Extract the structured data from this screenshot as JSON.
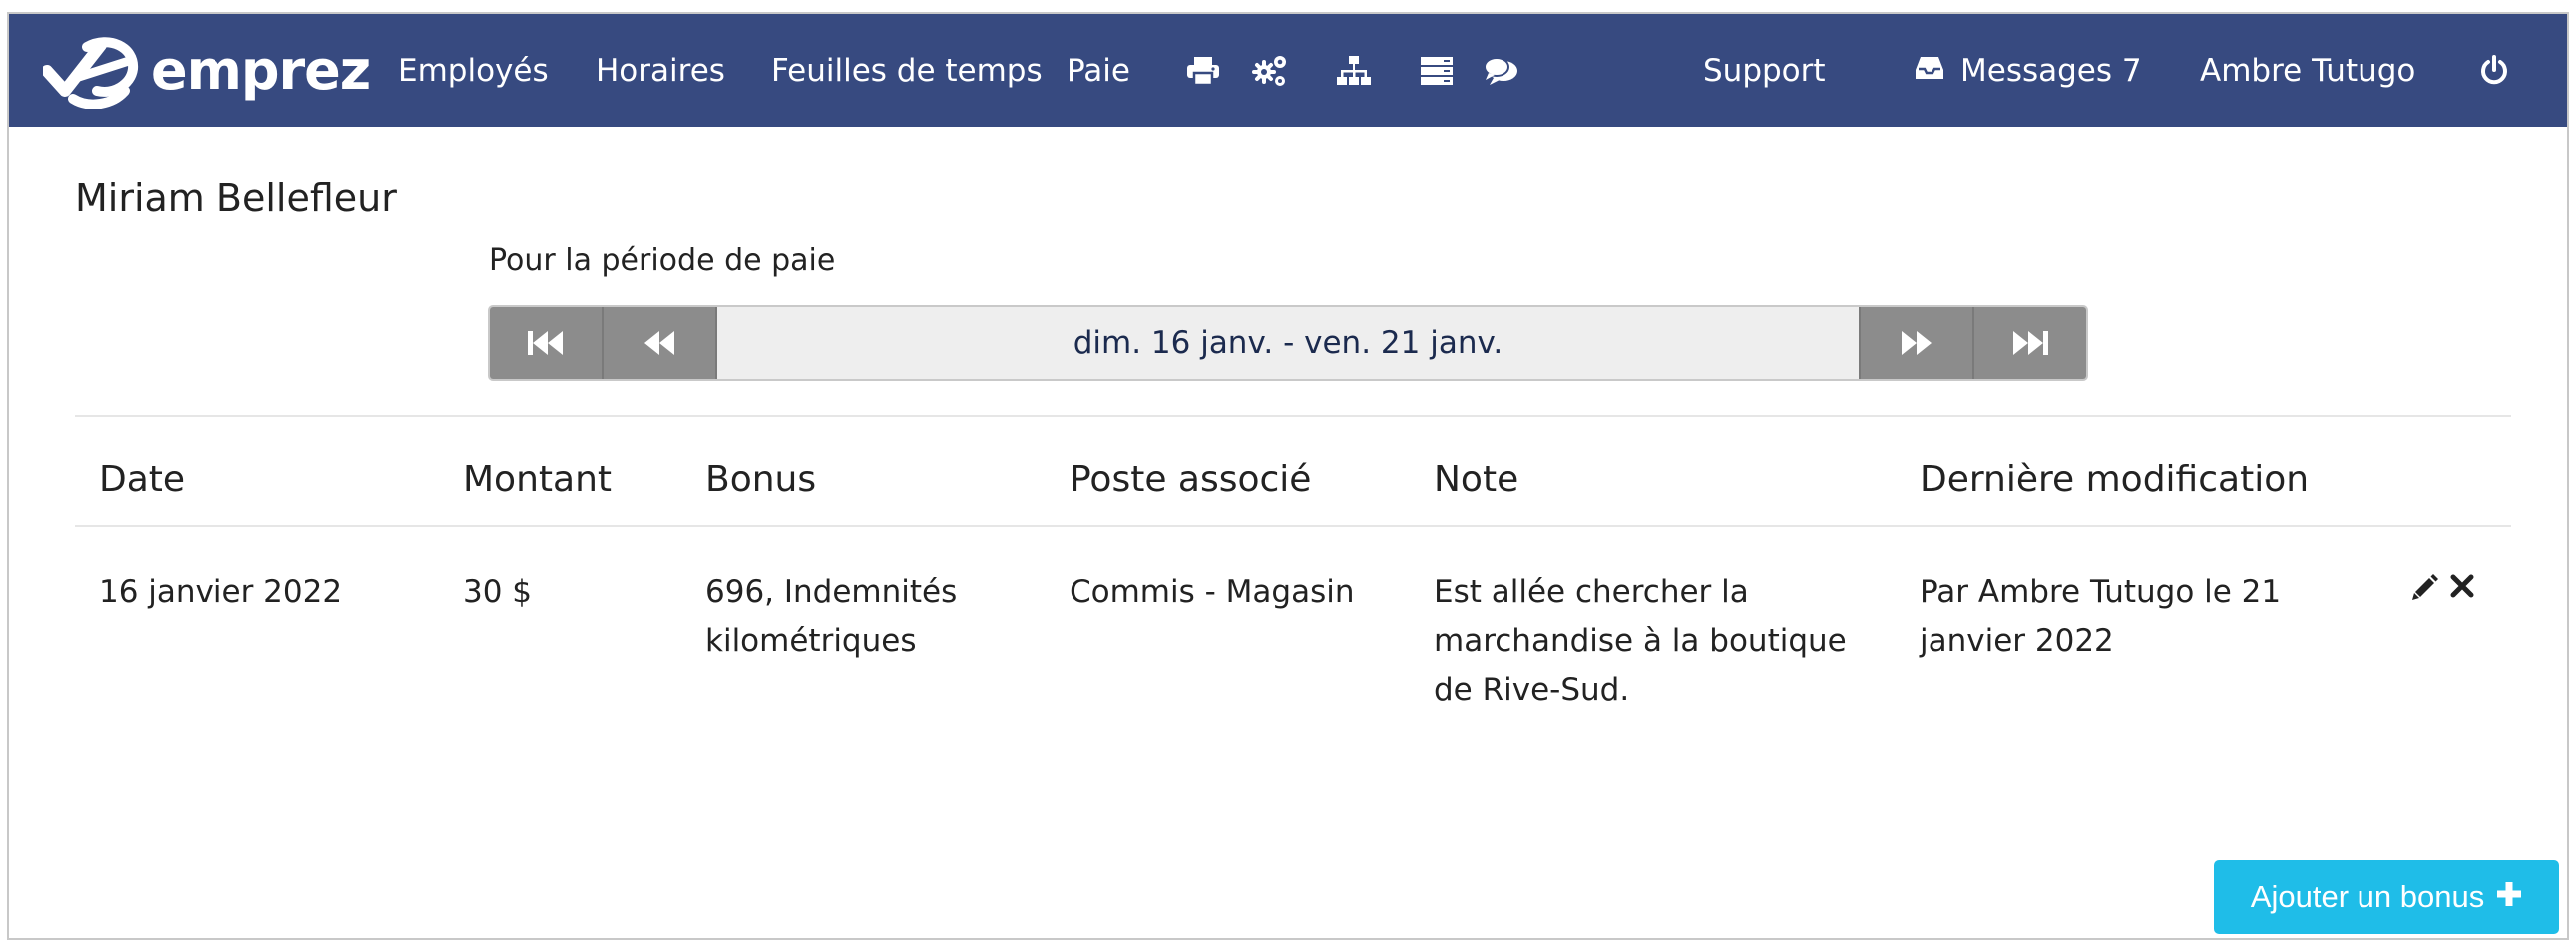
{
  "brand": {
    "name": "emprez"
  },
  "nav": {
    "employees": "Employés",
    "schedules": "Horaires",
    "timesheets": "Feuilles de temps",
    "pay": "Paie",
    "support": "Support",
    "messages": "Messages 7",
    "user": "Ambre Tutugo"
  },
  "page": {
    "employee_name": "Miriam Bellefleur",
    "period_label": "Pour la période de paie",
    "period_range": "dim. 16 janv. - ven. 21 janv."
  },
  "table": {
    "headers": {
      "date": "Date",
      "amount": "Montant",
      "bonus": "Bonus",
      "position": "Poste associé",
      "note": "Note",
      "modified": "Dernière modification"
    },
    "rows": [
      {
        "date": "16 janvier 2022",
        "amount": "30 $",
        "bonus": "696, Indemnités kilométriques",
        "position": "Commis - Magasin",
        "note": "Est allée chercher la marchandise à la boutique de Rive-Sud.",
        "modified": "Par Ambre Tutugo le 21 janvier 2022"
      }
    ]
  },
  "actions": {
    "add_bonus": "Ajouter un bonus"
  },
  "colors": {
    "navbar": "#374a80",
    "primary_button": "#1fbde8",
    "pager_button": "#8c8c8c"
  },
  "icons": [
    "print-icon",
    "cogs-icon",
    "sitemap-icon",
    "server-icon",
    "comments-icon",
    "inbox-icon",
    "power-icon",
    "pencil-icon",
    "times-icon",
    "plus-icon",
    "step-backward-icon",
    "backward-icon",
    "forward-icon",
    "step-forward-icon"
  ]
}
